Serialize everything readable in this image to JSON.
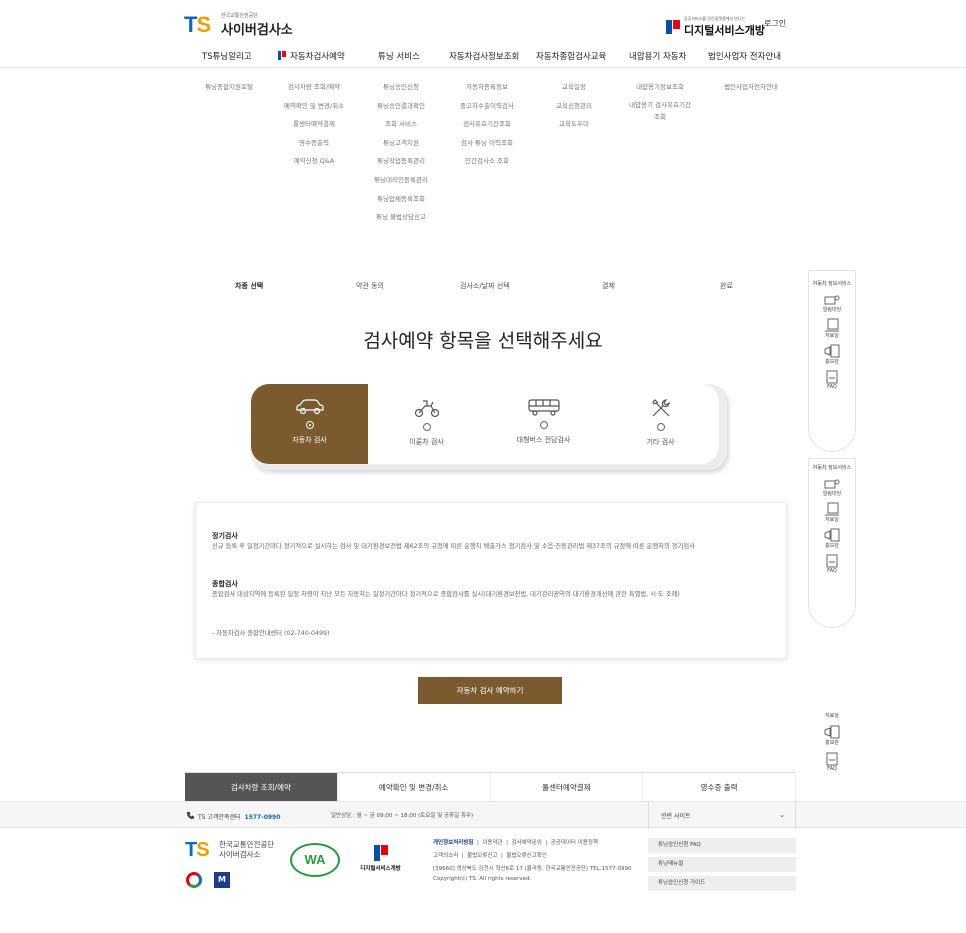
{
  "header": {
    "logo_sub": "한국교통안전공단",
    "logo_main": "사이버검사소",
    "dsg_small": "공공서비스를 민간플랫폼에서 만나는",
    "dsg_big": "디지털서비스개방",
    "login": "로그인"
  },
  "gnb": [
    "TS튜닝알리고",
    "자동차검사예약",
    "튜닝 서비스",
    "자동차검사정보조회",
    "자동차종합검사교육",
    "내압용기 자동차",
    "법인사업자 전자안내"
  ],
  "mega": [
    [
      "튜닝종합지원포털"
    ],
    [
      "검사차량 조회/예약",
      "예약확인 및 변경/취소",
      "툴센터예약결제",
      "영수증출력",
      "예약신청 Q&A"
    ],
    [
      "튜닝승인신청",
      "튜닝승인결과확인",
      "조회 서비스",
      "튜닝고객지원",
      "튜닝작업등록관리",
      "튜닝대리인등록관리",
      "튜닝업체등록조회",
      "튜닝 불법상담신고"
    ],
    [
      "자동차등록정보",
      "중고자수출이력검사",
      "검사유효기간조회",
      "검사·튜닝 이력조회",
      "민간검사소 조회"
    ],
    [
      "교육일정",
      "교육신청관리",
      "교육도우미"
    ],
    [
      "내압용기정보조회",
      "내압용기 검사유효기간",
      "조회"
    ],
    [
      "법인사업자전자안내"
    ]
  ],
  "steps": [
    "차종 선택",
    "약관 동의",
    "검사소/날짜 선택",
    "결제",
    "완료"
  ],
  "page_title": "검사예약 항목을 선택해주세요",
  "options": [
    {
      "label": "자동차 검사",
      "icon": "car-icon",
      "selected": true
    },
    {
      "label": "이륜차 검사",
      "icon": "motorcycle-icon",
      "selected": false
    },
    {
      "label": "대형버스 전담검사",
      "icon": "bus-icon",
      "selected": false
    },
    {
      "label": "기타 검사",
      "icon": "tools-icon",
      "selected": false
    }
  ],
  "info": {
    "h1": "정기검사",
    "p1": "신규 등록 후 일정기간마다 정기적으로 실시하는 검사 및 대기환경보전법 제62조의 규정에 따른 운행차 배출가스 정기검사 및 소음·진동관리법 제37조의 규정에 따른 운행차의 정기검사",
    "h2": "종합검사",
    "p2": "종합검사 대상지역에 등록된 일정 차령이 지난 모든 자동차는 일정기간마다 정기적으로 종합검사를 실시(대기환경보전법, 대기관리권역의 대기환경개선에 관한 특별법, 시·도 조례)",
    "p3": "- 자동차검사 종합안내센터 (02-740-0499)"
  },
  "cta": "자동차 검사 예약하기",
  "quick_menu": {
    "title": "자동차 정보서비스",
    "items": [
      "알림마당",
      "자료실",
      "홍보관",
      "FAQ"
    ],
    "items_short": [
      "자료실",
      "홍보관",
      "FAQ"
    ]
  },
  "bottom_tabs": [
    "검사차량 조회/예약",
    "예약확인 및 변경/취소",
    "툴센터예약결제",
    "영수증 출력"
  ],
  "footer": {
    "call_label": "TS 고객만족센터",
    "call_number": "1577-0990",
    "hours": "일반상담 : 월 ~ 금 09:00 ~ 18:00 (토요일 및 공휴일 휴무)",
    "related": "관련 사이트",
    "logo_main": "한국교통안전공단",
    "logo_sub": "사이버검사소",
    "wa_label": "WA",
    "dsg_big": "디지털서비스개방",
    "links1": [
      "개인정보처리방침",
      "이용약관",
      "검사예약문의",
      "공공데이터 이용정책"
    ],
    "links2": [
      "고객의소리",
      "불법오류신고",
      "불법오류신고확인"
    ],
    "address": "[39660] 경상북도 김천시 혁신6로 17 (율곡동, 한국교통안전공단) TEL.1577-0990",
    "copyright": "Copyright(c) TS. All rights reserved.",
    "quick_buttons": [
      "튜닝승인신청 FAQ",
      "튜닝매뉴얼",
      "튜닝승인신청 가이드"
    ]
  },
  "colors": {
    "accent": "#7a5a2e",
    "brand_blue": "#0a6db3",
    "brand_red": "#e60012"
  }
}
